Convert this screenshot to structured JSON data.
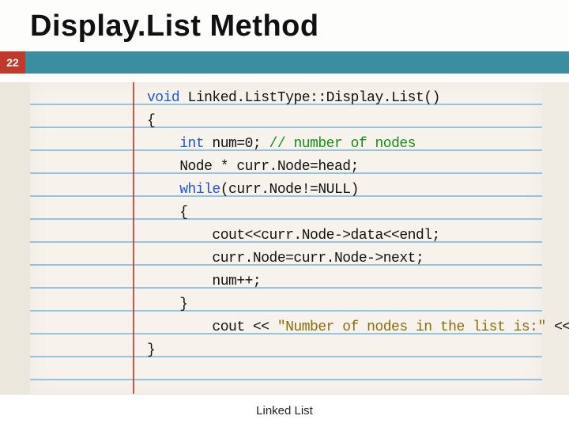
{
  "slide": {
    "title": "Display.List Method",
    "page_number": "22",
    "footer": "Linked List"
  },
  "code": {
    "l1_kw": "void",
    "l1_rest": " Linked.ListType::Display.List()",
    "l2": "{",
    "l3_kw": "int",
    "l3_mid": " num=0; ",
    "l3_cmt": "// number of nodes",
    "l4": "    Node * curr.Node=head;",
    "l5_kw": "while",
    "l5_rest": "(curr.Node!=NULL)",
    "l6": "    {",
    "l7": "        cout<<curr.Node->data<<endl;",
    "l8": "        curr.Node=curr.Node->next;",
    "l9": "        num++;",
    "l10": "    }",
    "l11_a": "        cout << ",
    "l11_str": "\"Number of nodes in the list is:\"",
    "l11_b": " << num << endl;",
    "l12": "}"
  }
}
